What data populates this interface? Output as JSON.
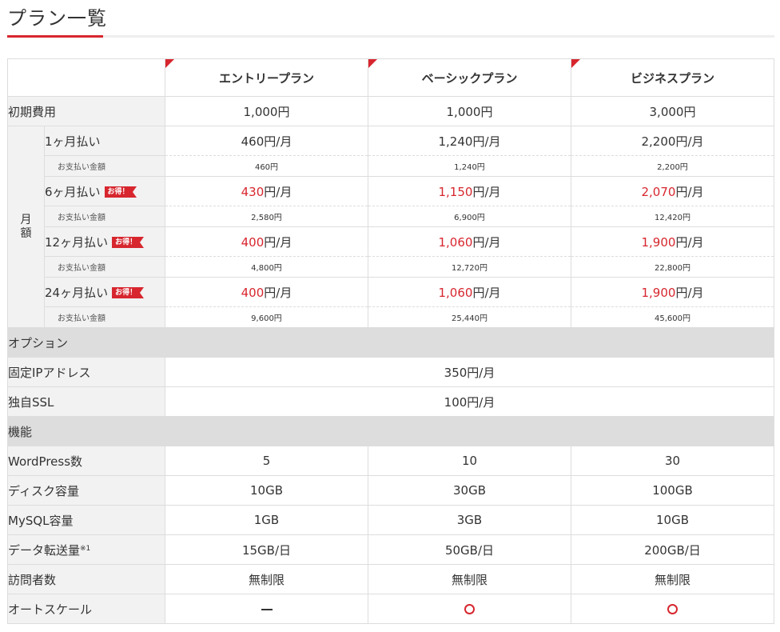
{
  "page": {
    "title": "プラン一覧"
  },
  "colors": {
    "accent": "#d7262e",
    "label_bg": "#f2f2f2",
    "section_bg": "#dddddd",
    "border": "#dddddd"
  },
  "plans": [
    "エントリープラン",
    "ベーシックプラン",
    "ビジネスプラン"
  ],
  "setup": {
    "label": "初期費用",
    "values": [
      "1,000円",
      "1,000円",
      "3,000円"
    ]
  },
  "monthly": {
    "group_label": "月額",
    "unit": "円/月",
    "payment_label": "お支払い金額",
    "badge": "お得！",
    "periods": [
      {
        "label": "1ヶ月払い",
        "prices": [
          "460",
          "1,240",
          "2,200"
        ],
        "totals": [
          "460円",
          "1,240円",
          "2,200円"
        ],
        "badge": false
      },
      {
        "label": "6ヶ月払い",
        "prices": [
          "430",
          "1,150",
          "2,070"
        ],
        "totals": [
          "2,580円",
          "6,900円",
          "12,420円"
        ],
        "badge": true
      },
      {
        "label": "12ヶ月払い",
        "prices": [
          "400",
          "1,060",
          "1,900"
        ],
        "totals": [
          "4,800円",
          "12,720円",
          "22,800円"
        ],
        "badge": true
      },
      {
        "label": "24ヶ月払い",
        "prices": [
          "400",
          "1,060",
          "1,900"
        ],
        "totals": [
          "9,600円",
          "25,440円",
          "45,600円"
        ],
        "badge": true
      }
    ]
  },
  "options": {
    "section_label": "オプション",
    "rows": [
      {
        "label": "固定IPアドレス",
        "value": "350円/月"
      },
      {
        "label": "独自SSL",
        "value": "100円/月"
      }
    ]
  },
  "features": {
    "section_label": "機能",
    "rows": [
      {
        "label": "WordPress数",
        "values": [
          "5",
          "10",
          "30"
        ]
      },
      {
        "label": "ディスク容量",
        "values": [
          "10GB",
          "30GB",
          "100GB"
        ]
      },
      {
        "label": "MySQL容量",
        "values": [
          "1GB",
          "3GB",
          "10GB"
        ]
      },
      {
        "label": "データ転送量",
        "note": "※1",
        "values": [
          "15GB/日",
          "50GB/日",
          "200GB/日"
        ]
      },
      {
        "label": "訪問者数",
        "values": [
          "無制限",
          "無制限",
          "無制限"
        ]
      },
      {
        "label": "オートスケール",
        "marks": [
          "dash",
          "circle",
          "circle"
        ]
      }
    ]
  }
}
